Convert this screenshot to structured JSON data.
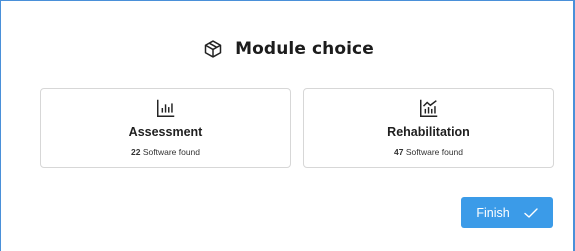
{
  "header": {
    "title": "Module choice",
    "icon": "cube-icon"
  },
  "cards": [
    {
      "title": "Assessment",
      "count": "22",
      "suffix": "Software found",
      "icon": "bar-chart-icon"
    },
    {
      "title": "Rehabilitation",
      "count": "47",
      "suffix": "Software found",
      "icon": "line-bar-chart-icon"
    }
  ],
  "footer": {
    "finish_label": "Finish",
    "icon": "check-icon"
  },
  "colors": {
    "accent": "#3b9be8",
    "frame": "#4a90d9",
    "card_border": "#d7d7d7"
  }
}
